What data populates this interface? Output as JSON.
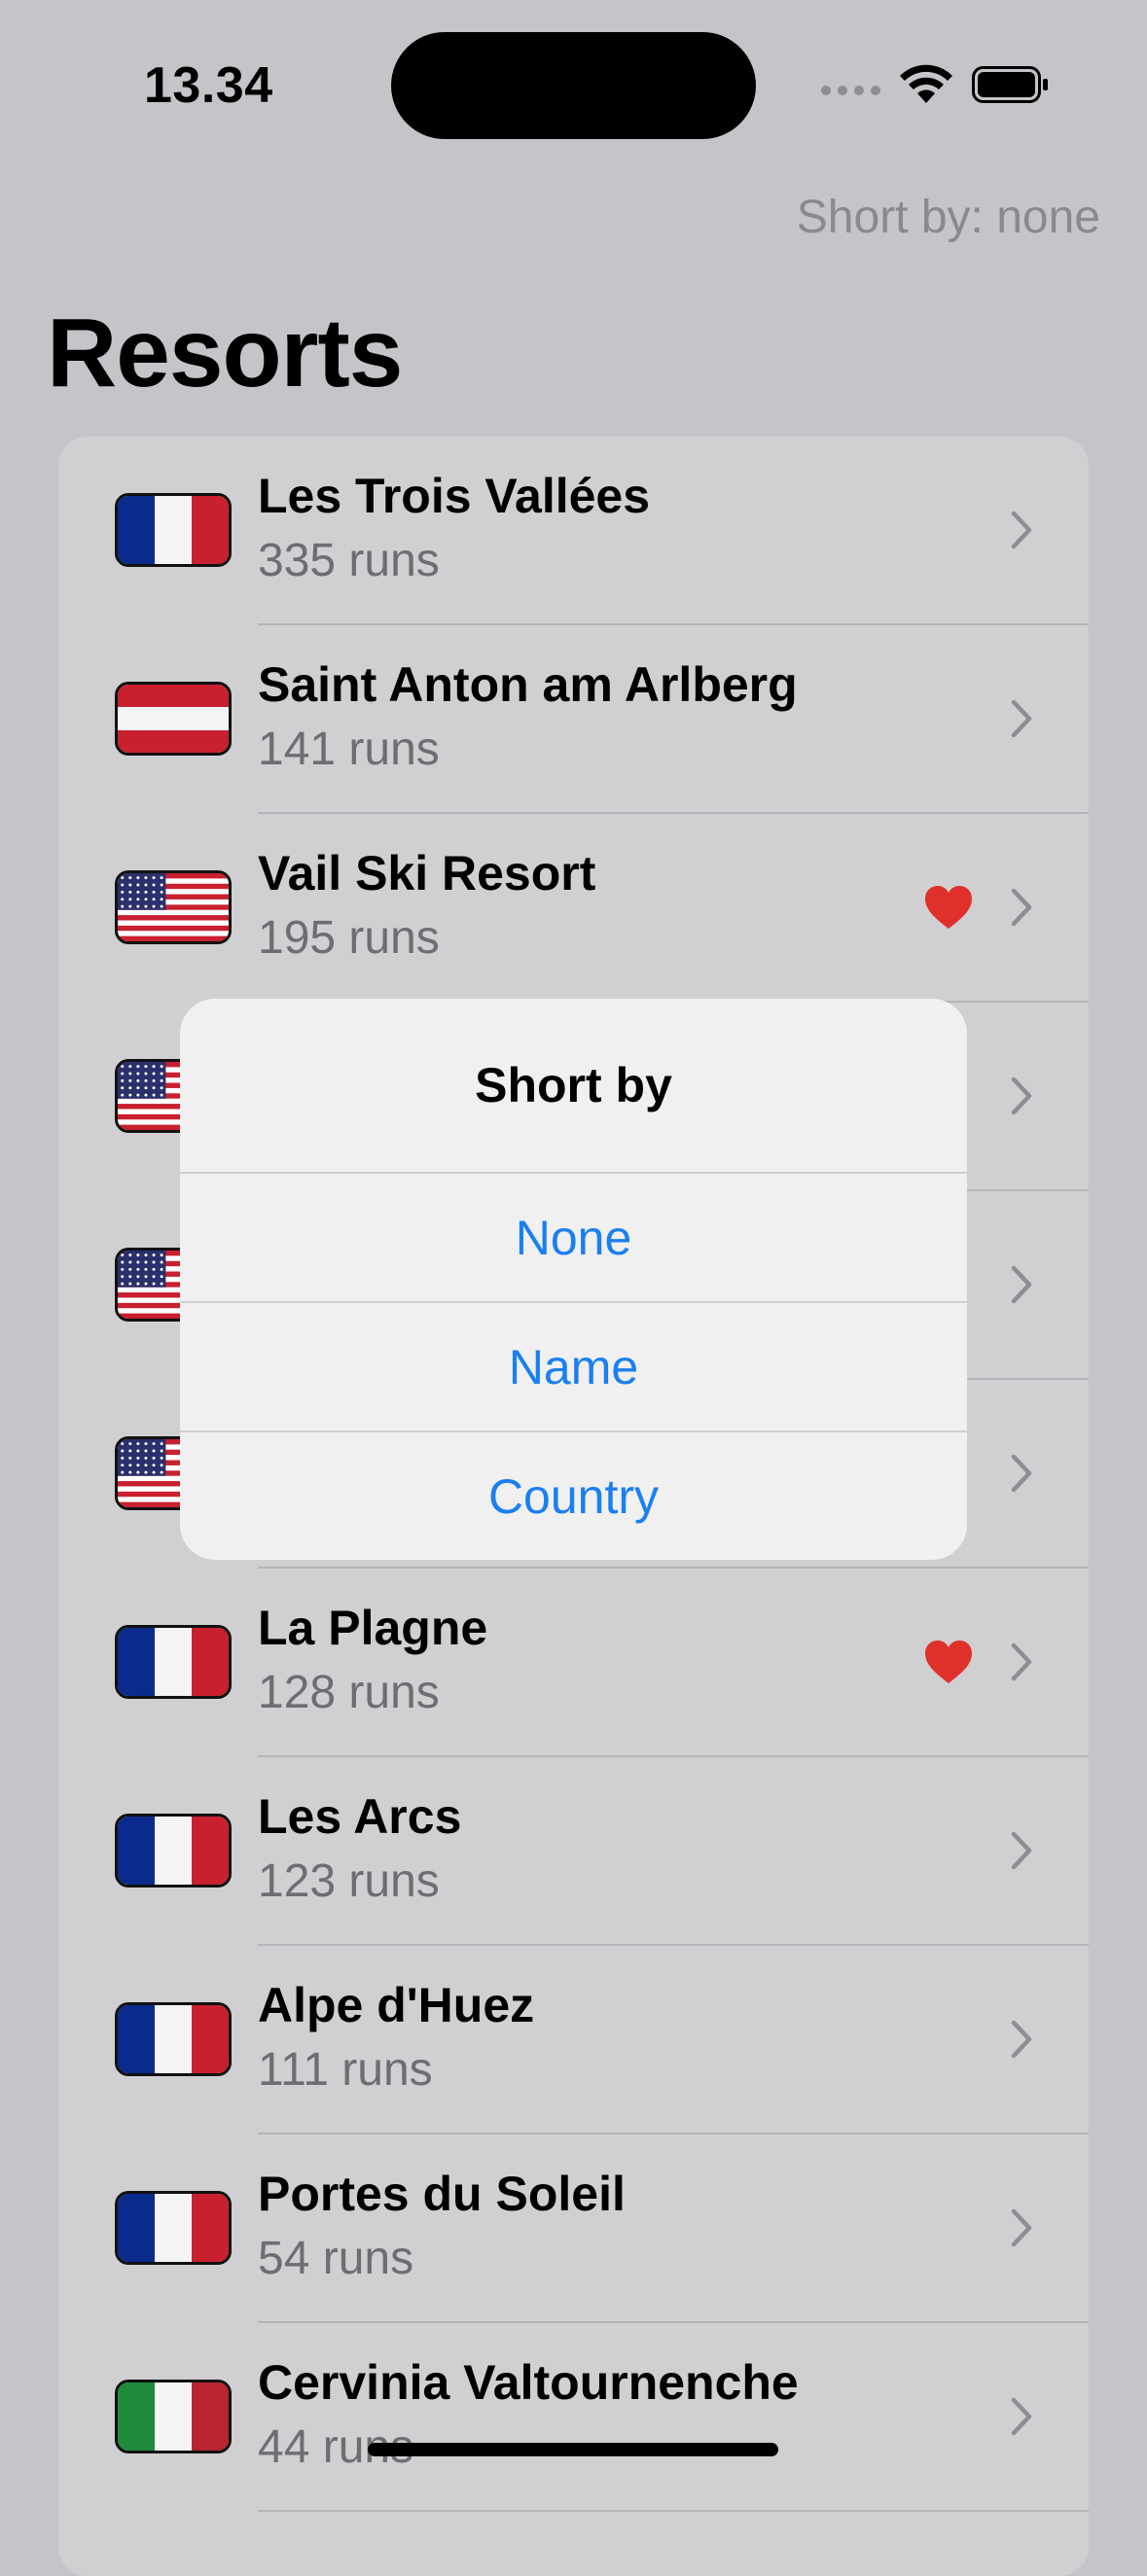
{
  "status_bar": {
    "time": "13.34"
  },
  "nav": {
    "sort_label": "Short by: none",
    "title": "Resorts"
  },
  "resorts": [
    {
      "name": "Les Trois Vallées",
      "runs": "335 runs",
      "flag": "france",
      "favorite": false
    },
    {
      "name": "Saint Anton am Arlberg",
      "runs": "141 runs",
      "flag": "austria",
      "favorite": false
    },
    {
      "name": "Vail Ski Resort",
      "runs": "195 runs",
      "flag": "usa",
      "favorite": true
    },
    {
      "name": "",
      "runs": "",
      "flag": "usa",
      "favorite": false
    },
    {
      "name": "",
      "runs": "",
      "flag": "usa",
      "favorite": false
    },
    {
      "name": "",
      "runs": "",
      "flag": "usa",
      "favorite": false
    },
    {
      "name": "La Plagne",
      "runs": "128 runs",
      "flag": "france",
      "favorite": true
    },
    {
      "name": "Les Arcs",
      "runs": "123 runs",
      "flag": "france",
      "favorite": false
    },
    {
      "name": "Alpe d'Huez",
      "runs": "111 runs",
      "flag": "france",
      "favorite": false
    },
    {
      "name": "Portes du Soleil",
      "runs": "54 runs",
      "flag": "france",
      "favorite": false
    },
    {
      "name": "Cervinia Valtournenche",
      "runs": "44 runs",
      "flag": "italy",
      "favorite": false
    }
  ],
  "sort_dialog": {
    "title": "Short by",
    "options": [
      "None",
      "Name",
      "Country"
    ]
  },
  "colors": {
    "accent": "#1a7ff0",
    "heart": "#e0302b",
    "background": "#c5c5c9"
  }
}
